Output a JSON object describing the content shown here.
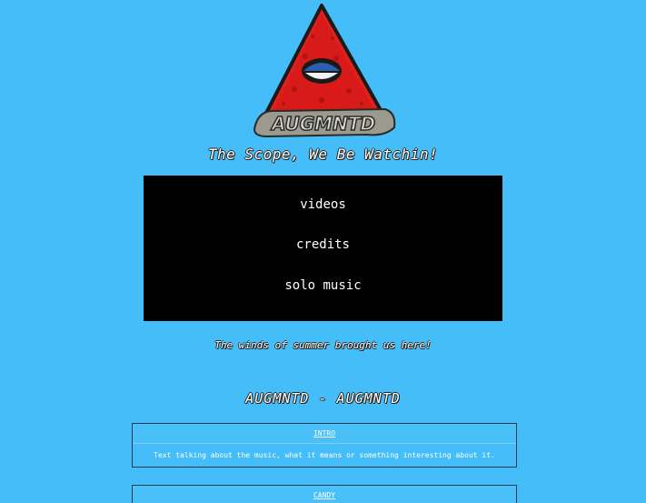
{
  "header": {
    "logo_icon": "augmntd-eye-triangle-logo",
    "logo_text": "AUGMNTD",
    "tagline": "The Scope, We Be Watchin!"
  },
  "nav": {
    "items": [
      {
        "label": "videos"
      },
      {
        "label": "credits"
      },
      {
        "label": "solo music"
      }
    ]
  },
  "subtagline": "The winds of summer brought us here!",
  "album": {
    "title": "AUGMNTD - AUGMNTD",
    "tracks": [
      {
        "name": "INTRO",
        "description": "Text talking about the music, what it means or something interesting about it."
      },
      {
        "name": "CANDY",
        "description": ""
      }
    ]
  },
  "colors": {
    "background": "#45bdf8",
    "nav_background": "#000000",
    "logo_red": "#e02020",
    "text": "#ffffff"
  }
}
